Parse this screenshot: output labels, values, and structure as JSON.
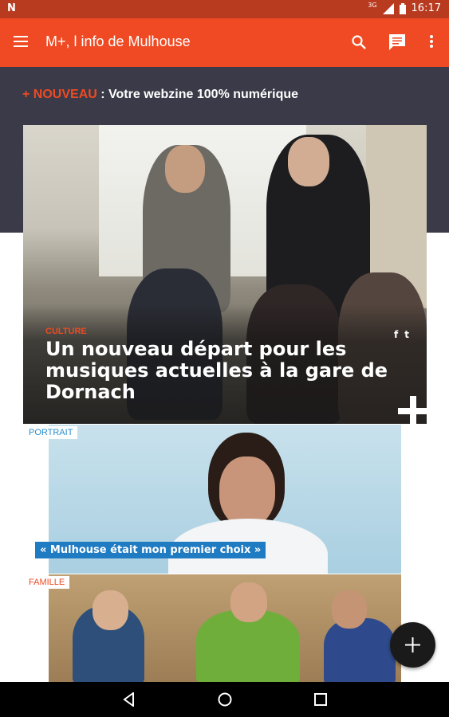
{
  "status_bar": {
    "app_icon": "N",
    "network_label": "3G",
    "time": "16:17"
  },
  "appbar": {
    "title": "M+, l info de Mulhouse"
  },
  "banner": {
    "plus": "+",
    "nouveau": "NOUVEAU",
    "text": " : Votre webzine 100% numérique"
  },
  "hero": {
    "category": "CULTURE",
    "headline": "Un nouveau départ pour les musiques actuelles à la gare de Dornach",
    "social_facebook": "f",
    "social_twitter": "t"
  },
  "portrait": {
    "tag": "PORTRAIT",
    "quote": "« Mulhouse était mon premier choix »"
  },
  "famille": {
    "tag": "FAMILLE"
  },
  "colors": {
    "accent": "#ef4a23",
    "status": "#b83a1f",
    "quote_blue": "#1f7bc2"
  }
}
